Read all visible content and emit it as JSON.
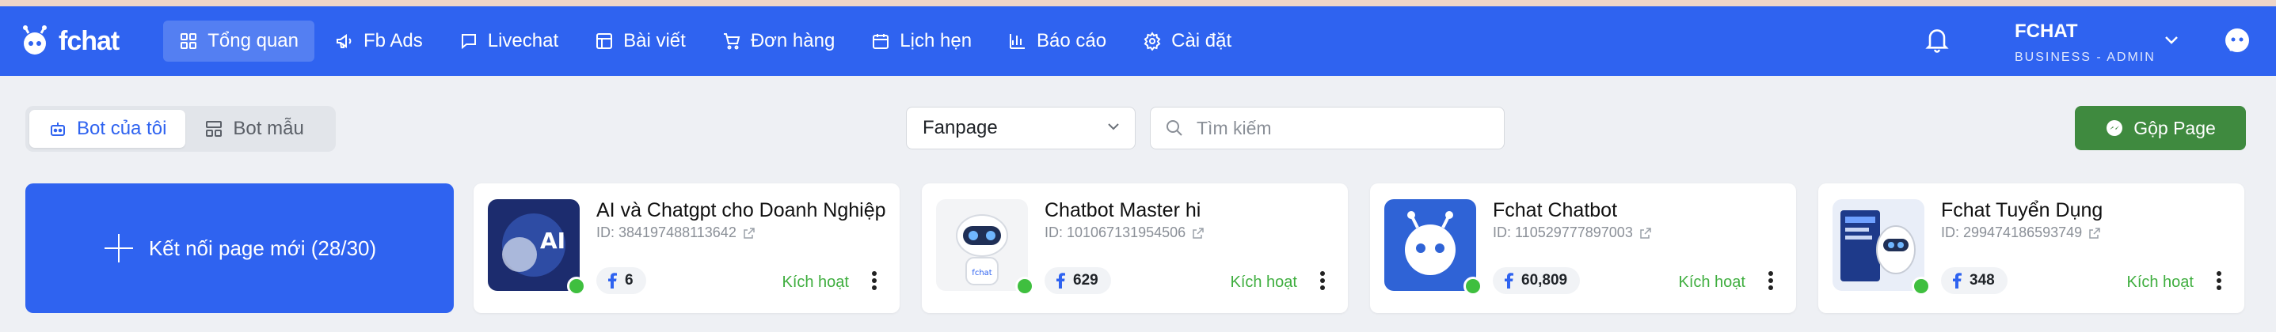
{
  "brand": {
    "name": "fchat"
  },
  "nav": {
    "items": [
      {
        "label": "Tổng quan",
        "icon": "dashboard-icon",
        "active": true
      },
      {
        "label": "Fb Ads",
        "icon": "megaphone-icon",
        "active": false
      },
      {
        "label": "Livechat",
        "icon": "chat-bubble-icon",
        "active": false
      },
      {
        "label": "Bài viết",
        "icon": "layout-icon",
        "active": false
      },
      {
        "label": "Đơn hàng",
        "icon": "cart-icon",
        "active": false
      },
      {
        "label": "Lịch hẹn",
        "icon": "calendar-icon",
        "active": false
      },
      {
        "label": "Báo cáo",
        "icon": "bar-chart-icon",
        "active": false
      },
      {
        "label": "Cài đặt",
        "icon": "gear-icon",
        "active": false
      }
    ]
  },
  "user": {
    "name": "FCHAT",
    "role": "BUSINESS - ADMIN"
  },
  "tabs": {
    "my_bots": "Bot của tôi",
    "template_bots": "Bot mẫu"
  },
  "filter": {
    "select_value": "Fanpage",
    "search_placeholder": "Tìm kiếm"
  },
  "actions": {
    "merge_label": "Gộp Page",
    "connect_label": "Kết nối page mới (28/30)"
  },
  "pages": [
    {
      "name": "AI và Chatgpt cho Doanh Nghiệp",
      "id": "ID: 384197488113642",
      "count": "6",
      "status": "Kích hoạt"
    },
    {
      "name": "Chatbot Master hi",
      "id": "ID: 101067131954506",
      "count": "629",
      "status": "Kích hoạt"
    },
    {
      "name": "Fchat Chatbot",
      "id": "ID: 110529777897003",
      "count": "60,809",
      "status": "Kích hoạt"
    },
    {
      "name": "Fchat Tuyển Dụng",
      "id": "ID: 299474186593749",
      "count": "348",
      "status": "Kích hoạt"
    }
  ],
  "avatar_labels": {
    "ai": "AI",
    "bot": "fchat"
  },
  "colors": {
    "primary": "#2f63f0",
    "success": "#3f8a3f",
    "status": "#3fae3f"
  }
}
